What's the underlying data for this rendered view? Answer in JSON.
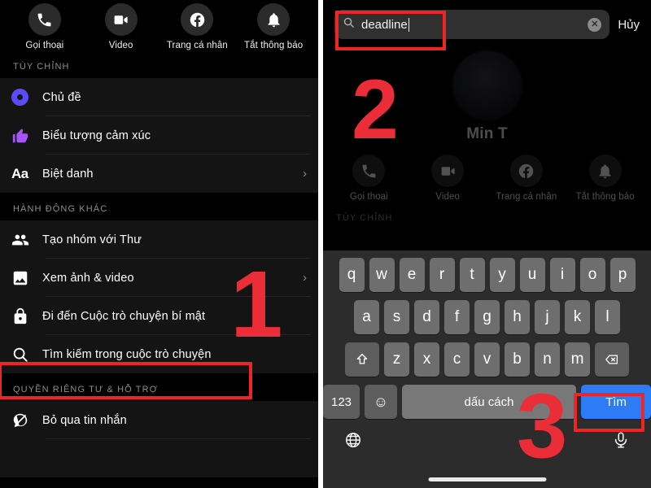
{
  "quick_actions": [
    {
      "icon": "phone-icon",
      "label": "Gọi thoại"
    },
    {
      "icon": "video-icon",
      "label": "Video"
    },
    {
      "icon": "facebook-icon",
      "label": "Trang cá nhân"
    },
    {
      "icon": "bell-icon",
      "label": "Tắt thông báo"
    }
  ],
  "left_panel": {
    "sections": [
      {
        "header": "TÙY CHỈNH"
      },
      {
        "header": "HÀNH ĐỘNG KHÁC"
      },
      {
        "header": "QUYỀN RIÊNG TƯ & HỖ TRỢ"
      }
    ],
    "customize_items": [
      {
        "icon": "theme-circle-icon",
        "label": "Chủ đề",
        "chevron": ""
      },
      {
        "icon": "thumbs-up-icon",
        "label": "Biểu tượng cảm xúc",
        "chevron": ""
      },
      {
        "icon": "aa-text-icon",
        "label": "Biệt danh",
        "chevron": "›"
      }
    ],
    "other_actions": [
      {
        "icon": "people-group-icon",
        "label": "Tạo nhóm với Thư",
        "chevron": ""
      },
      {
        "icon": "photo-icon",
        "label": "Xem ảnh & video",
        "chevron": "›"
      },
      {
        "icon": "lock-icon",
        "label": "Đi đến Cuộc trò chuyện bí mật",
        "chevron": ""
      },
      {
        "icon": "search-icon",
        "label": "Tìm kiếm trong cuộc trò chuyện",
        "chevron": ""
      }
    ],
    "privacy_items": [
      {
        "icon": "ignore-messages-icon",
        "label": "Bỏ qua tin nhắn",
        "chevron": ""
      }
    ]
  },
  "right_panel": {
    "search": {
      "icon": "search-icon",
      "value": "deadline",
      "clear_label": "✕",
      "cancel_label": "Hủy"
    },
    "profile": {
      "name": "Min  T",
      "avatar": "user-avatar"
    },
    "section_header": "TÙY CHỈNH",
    "keyboard": {
      "row1": [
        "q",
        "w",
        "e",
        "r",
        "t",
        "y",
        "u",
        "i",
        "o",
        "p"
      ],
      "row2": [
        "a",
        "s",
        "d",
        "f",
        "g",
        "h",
        "j",
        "k",
        "l"
      ],
      "row3": [
        "z",
        "x",
        "c",
        "v",
        "b",
        "n",
        "m"
      ],
      "shift_icon": "shift-icon",
      "backspace_icon": "backspace-icon",
      "numbers_label": "123",
      "emoji_label": "☺",
      "space_label": "dấu cách",
      "go_label": "Tìm",
      "globe_icon": "globe-icon",
      "mic_icon": "microphone-icon"
    }
  },
  "annotations": {
    "step1": "1",
    "step2": "2",
    "step3": "3",
    "highlight_color": "#ef2525",
    "go_key_color": "#2d7cf6"
  }
}
